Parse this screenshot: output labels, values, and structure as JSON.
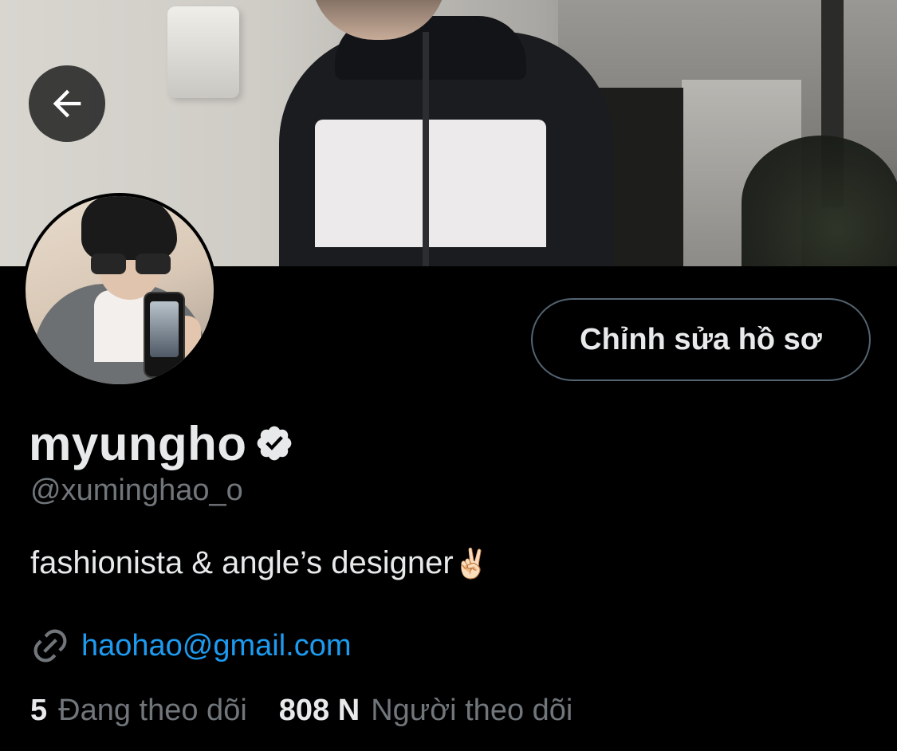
{
  "header": {
    "back_icon": "arrow-left-icon"
  },
  "profile": {
    "edit_button_label": "Chỉnh sửa hồ sơ",
    "display_name": "myungho",
    "verified_icon": "verified-badge-icon",
    "handle": "@xuminghao_o",
    "bio": "fashionista & angle’s designer",
    "bio_emoji": "✌🏻",
    "link_icon": "link-icon",
    "link_text": "haohao@gmail.com"
  },
  "stats": {
    "following_count": "5",
    "following_label": "Đang theo dõi",
    "followers_count": "808 N",
    "followers_label": "Người theo dõi"
  },
  "colors": {
    "background": "#000000",
    "primary_text": "#e7e9ea",
    "secondary_text": "#71767b",
    "link": "#1d9bf0",
    "button_border": "#536471"
  }
}
